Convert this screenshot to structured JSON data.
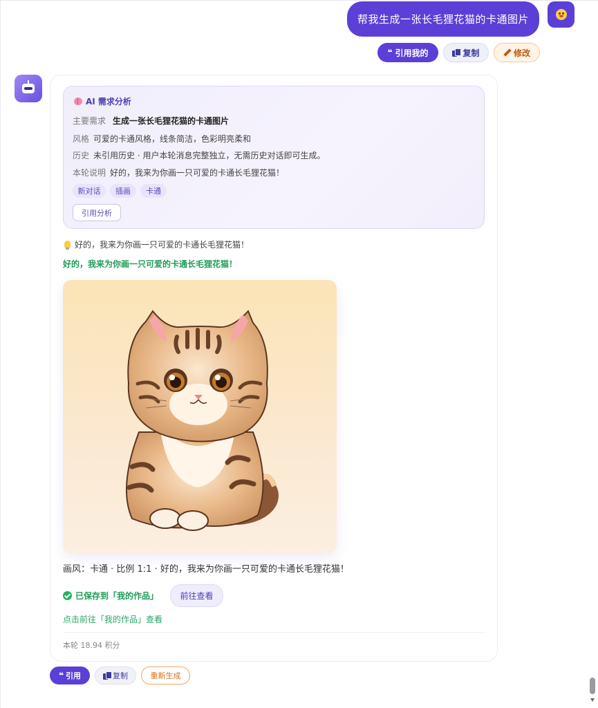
{
  "user_message": {
    "text": "帮我生成一张长毛狸花猫的卡通图片",
    "actions": {
      "quote_label": "引用我的",
      "copy_label": "复制",
      "edit_label": "修改"
    }
  },
  "analysis": {
    "title": "AI 需求分析",
    "rows": [
      {
        "key": "主要需求",
        "value": "生成一张长毛狸花猫的卡通图片"
      },
      {
        "key": "风格",
        "value": "可爱的卡通风格，线条简洁，色彩明亮柔和"
      },
      {
        "key": "历史",
        "value": "未引用历史 · 用户本轮消息完整独立，无需历史对话即可生成。"
      },
      {
        "key": "本轮说明",
        "value": "好的，我来为你画一只可爱的卡通长毛狸花猫！"
      }
    ],
    "tags": [
      "新对话",
      "插画",
      "卡通"
    ],
    "cite_button": "引用分析"
  },
  "reply": {
    "hint_line": "好的，我来为你画一只可爱的卡通长毛狸花猫！",
    "headline": "好的，我来为你画一只可爱的卡通长毛狸花猫！",
    "caption": "画风：卡通 · 比例 1:1 · 好的，我来为你画一只可爱的卡通长毛狸花猫！",
    "saved_text": "已保存到「我的作品」",
    "goto_button": "前往查看",
    "goto_link": "点击前往「我的作品」查看",
    "cost": "本轮 18.94 积分"
  },
  "bottom_actions": {
    "quote_label": "引用",
    "copy_label": "复制",
    "regen_label": "重新生成"
  },
  "colors": {
    "accent": "#5b3fd6",
    "success": "#1f9d57",
    "warning": "#d9701e"
  },
  "icons": {
    "user_avatar": "smiley-face-icon",
    "bot_avatar": "robot-icon",
    "analysis": "brain-icon",
    "hint": "lightbulb-icon",
    "saved": "check-circle-icon",
    "quote": "quote-icon",
    "copy": "copy-icon",
    "edit": "pencil-icon"
  }
}
